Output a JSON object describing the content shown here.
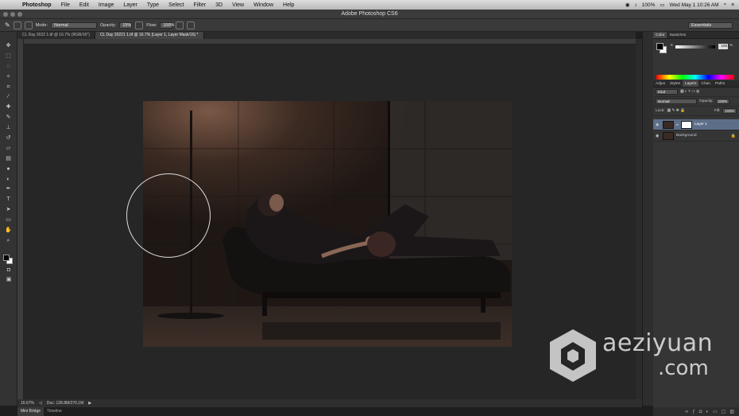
{
  "menubar": {
    "app": "Photoshop",
    "items": [
      "File",
      "Edit",
      "Image",
      "Layer",
      "Type",
      "Select",
      "Filter",
      "3D",
      "View",
      "Window",
      "Help"
    ],
    "battery": "100%",
    "datetime": "Wed May 1  10:26 AM"
  },
  "window": {
    "title": "Adobe Photoshop CS6"
  },
  "options": {
    "mode_label": "Mode:",
    "mode_value": "Normal",
    "opacity_label": "Opacity:",
    "opacity_value": "15%",
    "flow_label": "Flow:",
    "flow_value": "100%",
    "workspace": "Essentials"
  },
  "doc_tabs": [
    {
      "label": "CL Day 2022 1.tif @ 16.7% (RGB/16*)"
    },
    {
      "label": "CL Day 20221 1.tif @ 16.7% (Layer 1, Layer Mask/16) *"
    }
  ],
  "status": {
    "zoom": "16.67%",
    "doc": "Doc: 128.8M/270.1M"
  },
  "bottom_tabs": [
    "Mini Bridge",
    "Timeline"
  ],
  "color_panel": {
    "tabs": [
      "Color",
      "Swatches"
    ],
    "k_label": "K",
    "k_value": "100",
    "k_unit": "%"
  },
  "layers_panel": {
    "tabs": [
      "Adjus",
      "Styles",
      "Layers",
      "Chan",
      "Paths"
    ],
    "kind": "Kind",
    "blend": "Normal",
    "opacity_label": "Opacity:",
    "opacity_value": "100%",
    "lock_label": "Lock:",
    "fill_label": "Fill:",
    "fill_value": "100%",
    "layers": [
      {
        "name": "Layer 1",
        "selected": true
      },
      {
        "name": "Background",
        "selected": false
      }
    ]
  },
  "watermark": {
    "text1": "aeziyuan",
    "text2": ".com"
  }
}
